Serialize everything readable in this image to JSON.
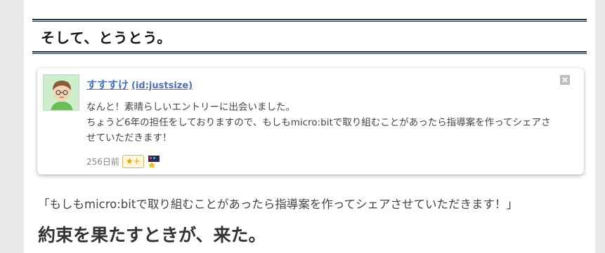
{
  "section": {
    "title": "そして、とうとう。"
  },
  "comment_card": {
    "username": "すすすけ",
    "user_id": "(id:justsize)",
    "lines": [
      "なんと！素晴らしいエントリーに出会いました。",
      "ちょうど6年の担任をしておりますので、もしもmicro:bitで取り組むことがあったら指導案を作ってシェアさ",
      "せていただきます！"
    ],
    "timestamp": "256日前",
    "star_button": "★+",
    "close_icon": "close-icon",
    "star_icon": "star-icon"
  },
  "body": {
    "quote": "「もしもmicro:bitで取り組むことがあったら指導案を作ってシェアさせていただきます！」",
    "heading": "約束を果たすときが、来た。"
  }
}
